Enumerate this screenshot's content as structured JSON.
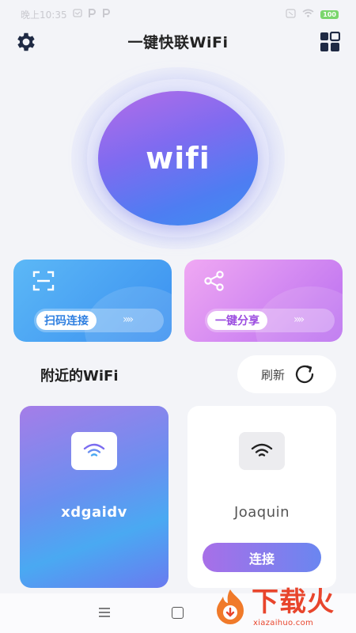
{
  "status_bar": {
    "time": "晚上10:35",
    "battery": "100"
  },
  "header": {
    "title": "一键快联WiFi"
  },
  "hero": {
    "label": "wifi"
  },
  "actions": {
    "scan": {
      "label": "扫码连接",
      "chevrons": "»»"
    },
    "share": {
      "label": "一键分享",
      "chevrons": "»»"
    }
  },
  "nearby": {
    "title": "附近的WiFi",
    "refresh_label": "刷新",
    "networks": [
      {
        "ssid": "xdgaidv",
        "active": true
      },
      {
        "ssid": "Joaquin",
        "connect_label": "连接"
      }
    ]
  },
  "watermark": {
    "brand": "下载火",
    "url": "xiazaihuo.com"
  },
  "colors": {
    "accent_blue": "#3a8ff0",
    "accent_purple": "#b96ef0",
    "background": "#f3f4f8"
  }
}
